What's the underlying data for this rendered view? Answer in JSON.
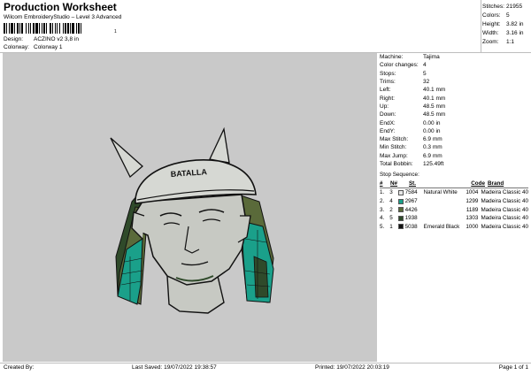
{
  "header": {
    "title": "Production Worksheet",
    "subtitle": "Wilcom EmbroideryStudio – Level 3 Advanced",
    "barcode_tail": "1",
    "design_label": "Design:",
    "design_value": "ACZINO v2 3,8 in",
    "colorway_label": "Colorway:",
    "colorway_value": "Colorway 1"
  },
  "stats": [
    {
      "label": "Stitches:",
      "value": "21955"
    },
    {
      "label": "Colors:",
      "value": "5"
    },
    {
      "label": "Height:",
      "value": "3.82 in"
    },
    {
      "label": "Width:",
      "value": "3.16 in"
    },
    {
      "label": "Zoom:",
      "value": "1:1"
    }
  ],
  "details": [
    {
      "label": "Machine:",
      "value": "Tajima"
    },
    {
      "label": "Color changes:",
      "value": "4"
    },
    {
      "label": "Stops:",
      "value": "5"
    },
    {
      "label": "Trims:",
      "value": "32"
    },
    {
      "label": "Left:",
      "value": "40.1 mm"
    },
    {
      "label": "Right:",
      "value": "40.1 mm"
    },
    {
      "label": "Up:",
      "value": "48.5 mm"
    },
    {
      "label": "Down:",
      "value": "48.5 mm"
    },
    {
      "label": "EndX:",
      "value": "0.00 in"
    },
    {
      "label": "EndY:",
      "value": "0.00 in"
    },
    {
      "label": "Max Stitch:",
      "value": "6.9 mm"
    },
    {
      "label": "Min Stitch:",
      "value": "0.3 mm"
    },
    {
      "label": "Max Jump:",
      "value": "6.9 mm"
    },
    {
      "label": "Total Bobbin:",
      "value": "125.49ft"
    }
  ],
  "stop_sequence": {
    "title": "Stop Sequence:",
    "headers": {
      "stop": "#",
      "n": "N#",
      "st": "St.",
      "code": "Code",
      "brand": "Brand"
    },
    "rows": [
      {
        "stop": "1.",
        "n": "3",
        "st": "7584",
        "name": "Natural White",
        "code": "1004",
        "brand": "Madeira Classic 40",
        "color": "#e6e6e6"
      },
      {
        "stop": "2.",
        "n": "4",
        "st": "2967",
        "name": "",
        "code": "1299",
        "brand": "Madeira Classic 40",
        "color": "#1aa08a"
      },
      {
        "stop": "3.",
        "n": "2",
        "st": "4426",
        "name": "",
        "code": "1189",
        "brand": "Madeira Classic 40",
        "color": "#5a6a3a"
      },
      {
        "stop": "4.",
        "n": "5",
        "st": "1938",
        "name": "",
        "code": "1303",
        "brand": "Madeira Classic 40",
        "color": "#2f4a2a"
      },
      {
        "stop": "5.",
        "n": "1",
        "st": "5038",
        "name": "Emerald Black",
        "code": "1000",
        "brand": "Madeira Classic 40",
        "color": "#111111"
      }
    ]
  },
  "design_art": {
    "cap_text": "BATALLA",
    "colors": {
      "canvas": "#c9c9c9",
      "skin": "#c7c9c3",
      "cap": "#d6d8d3",
      "teal": "#1aa08a",
      "olive": "#5a6a3a",
      "dark_green": "#2f4a2a",
      "black": "#111111"
    }
  },
  "footer": {
    "created": "Created By:",
    "saved": "Last Saved: 19/07/2022 19:38:57",
    "printed": "Printed: 19/07/2022 20:03:19",
    "page": "Page 1 of 1"
  }
}
